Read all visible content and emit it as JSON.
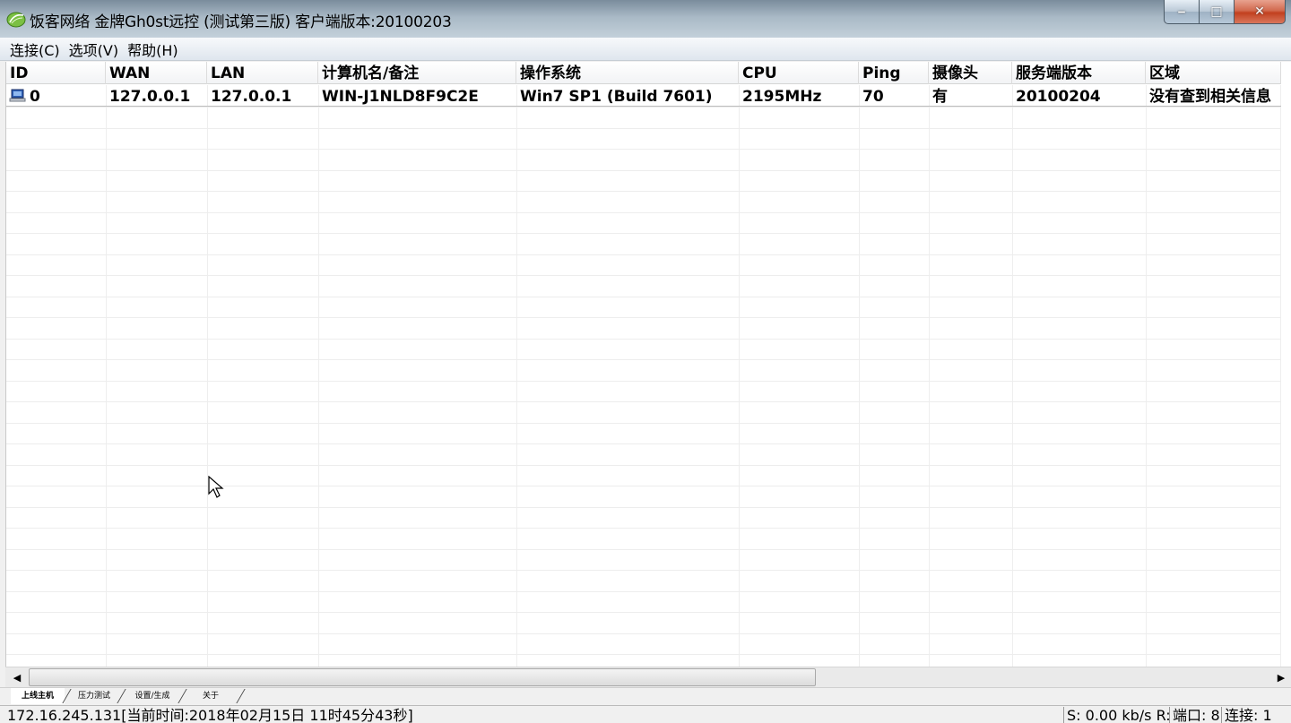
{
  "window": {
    "title": "饭客网络 金牌Gh0st远控 (测试第三版) 客户端版本:20100203",
    "icon": "app-leaf-icon",
    "controls": {
      "minimize": "minimize-icon",
      "maximize": "maximize-icon",
      "close": "close-icon"
    }
  },
  "menu": {
    "items": [
      {
        "label": "连接(C)"
      },
      {
        "label": "选项(V)"
      },
      {
        "label": "帮助(H)"
      }
    ]
  },
  "listview": {
    "columns": [
      {
        "label": "ID"
      },
      {
        "label": "WAN"
      },
      {
        "label": "LAN"
      },
      {
        "label": "计算机名/备注"
      },
      {
        "label": "操作系统"
      },
      {
        "label": "CPU"
      },
      {
        "label": "Ping"
      },
      {
        "label": "摄像头"
      },
      {
        "label": "服务端版本"
      },
      {
        "label": "区域"
      }
    ],
    "rows": [
      {
        "icon": "computer-icon",
        "cells": [
          "0",
          "127.0.0.1",
          "127.0.0.1",
          "WIN-J1NLD8F9C2E",
          "Win7 SP1 (Build 7601)",
          "2195MHz",
          "70",
          "有",
          "20100204",
          "没有查到相关信息"
        ]
      }
    ]
  },
  "tabs": [
    {
      "label": "上线主机",
      "active": true
    },
    {
      "label": "压力测试",
      "active": false
    },
    {
      "label": "设置/生成",
      "active": false
    },
    {
      "label": "关于",
      "active": false
    }
  ],
  "status": {
    "left": "172.16.245.131[当前时间:2018年02月15日 11时45分43秒]",
    "speed": "S: 0.00 kb/s R:",
    "port": "端口: 8",
    "connections": "连接: 1"
  },
  "colors": {
    "title_bar": "#a9b9c6",
    "close_button": "#c2401f",
    "list_background": "#ffffff"
  }
}
